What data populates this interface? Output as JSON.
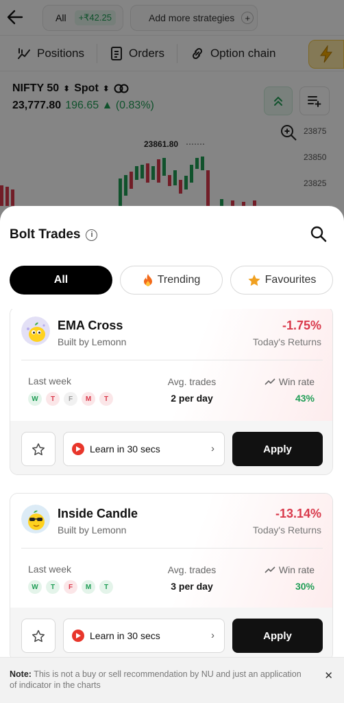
{
  "header": {
    "all_label": "All",
    "pnl": "+₹42.25",
    "add_strategies": "Add more strategies",
    "plus": "+"
  },
  "nav": {
    "positions": "Positions",
    "orders": "Orders",
    "option_chain": "Option chain"
  },
  "instrument": {
    "name": "NIFTY 50",
    "sort_glyph": "⬍",
    "mode": "Spot",
    "price": "23,777.80",
    "change": "196.65 ▲ (0.83%)"
  },
  "chart": {
    "high_label": "23861.80",
    "ticks": [
      "23875",
      "23850",
      "23825"
    ]
  },
  "sheet": {
    "title": "Bolt Trades",
    "info": "i",
    "tabs": {
      "all": "All",
      "trending": "Trending",
      "favourites": "Favourites"
    }
  },
  "cards": [
    {
      "name": "EMA Cross",
      "by": "Built by Lemonn",
      "returns": "-1.75%",
      "returns_label": "Today's Returns",
      "last_week_label": "Last week",
      "days": [
        {
          "d": "W",
          "s": "g"
        },
        {
          "d": "T",
          "s": "r"
        },
        {
          "d": "F",
          "s": "n"
        },
        {
          "d": "M",
          "s": "r"
        },
        {
          "d": "T",
          "s": "r"
        }
      ],
      "avg_label": "Avg. trades",
      "avg_value": "2 per day",
      "win_label": "Win rate",
      "win_value": "43%",
      "learn": "Learn in 30 secs",
      "apply": "Apply"
    },
    {
      "name": "Inside Candle",
      "by": "Built by Lemonn",
      "returns": "-13.14%",
      "returns_label": "Today's Returns",
      "last_week_label": "Last week",
      "days": [
        {
          "d": "W",
          "s": "g"
        },
        {
          "d": "T",
          "s": "g"
        },
        {
          "d": "F",
          "s": "r"
        },
        {
          "d": "M",
          "s": "g"
        },
        {
          "d": "T",
          "s": "g"
        }
      ],
      "avg_label": "Avg. trades",
      "avg_value": "3 per day",
      "win_label": "Win rate",
      "win_value": "30%",
      "learn": "Learn in 30 secs",
      "apply": "Apply"
    }
  ],
  "note": {
    "bold": "Note:",
    "text": " This is not a buy or sell recommendation by NU and just an application of indicator in the charts",
    "close": "✕"
  },
  "colors": {
    "positive": "#1f9d55",
    "negative": "#d9394b",
    "accent_dark": "#111111"
  }
}
